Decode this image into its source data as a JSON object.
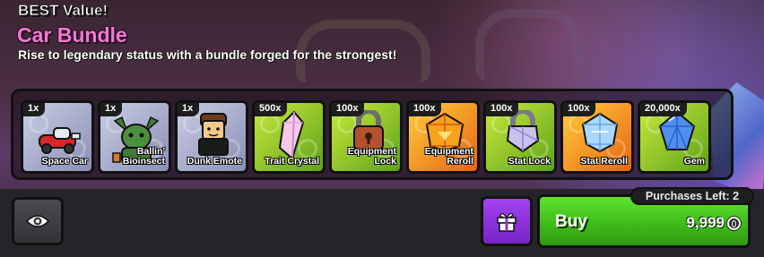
{
  "header": {
    "badge": "BEST Value!",
    "title": "Car Bundle",
    "subtitle": "Rise to legendary status with a bundle forged for the strongest!"
  },
  "items": [
    {
      "qty": "1x",
      "label": "Space Car",
      "tier": "grey",
      "icon": "space-car-icon"
    },
    {
      "qty": "1x",
      "label": "Ballin' Bioinsect",
      "tier": "grey",
      "icon": "bioinsect-icon"
    },
    {
      "qty": "1x",
      "label": "Dunk Emote",
      "tier": "grey",
      "icon": "dunk-emote-icon"
    },
    {
      "qty": "500x",
      "label": "Trait Crystal",
      "tier": "green",
      "icon": "trait-crystal-icon"
    },
    {
      "qty": "100x",
      "label": "Equipment Lock",
      "tier": "green",
      "icon": "equipment-lock-icon"
    },
    {
      "qty": "100x",
      "label": "Equipment Reroll",
      "tier": "orange",
      "icon": "equipment-reroll-icon"
    },
    {
      "qty": "100x",
      "label": "Stat Lock",
      "tier": "green",
      "icon": "stat-lock-icon"
    },
    {
      "qty": "100x",
      "label": "Stat Reroll",
      "tier": "orange",
      "icon": "stat-reroll-icon"
    },
    {
      "qty": "20,000x",
      "label": "Gem",
      "tier": "green",
      "icon": "gem-icon"
    }
  ],
  "footer": {
    "preview_icon": "eye-icon",
    "gift_icon": "gift-icon",
    "buy_label": "Buy",
    "price": "9,999",
    "currency_icon": "coin-icon",
    "purchases_left": "Purchases Left: 2"
  },
  "colors": {
    "title_pink": "#f07ad2",
    "buy_green": "#3fbc1a",
    "gift_purple": "#8a30d8"
  }
}
